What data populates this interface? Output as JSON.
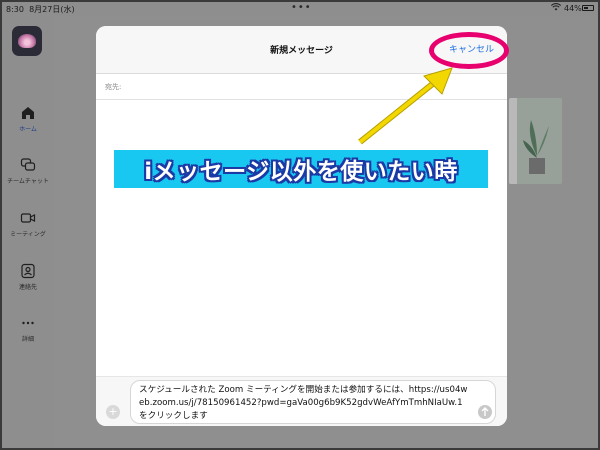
{
  "status_bar": {
    "time": "8:30",
    "date": "8月27日(水)",
    "battery": "44%"
  },
  "sidebar": {
    "items": [
      {
        "label": "ホーム",
        "icon": "home-icon",
        "active": true
      },
      {
        "label": "チームチャット",
        "icon": "chat-icon",
        "active": false
      },
      {
        "label": "ミーティング",
        "icon": "video-icon",
        "active": false
      },
      {
        "label": "連絡先",
        "icon": "contacts-icon",
        "active": false
      },
      {
        "label": "詳細",
        "icon": "more-icon",
        "active": false
      }
    ]
  },
  "modal": {
    "title": "新規メッセージ",
    "cancel_label": "キャンセル",
    "to_label": "宛先:",
    "message_text": "スケジュールされた Zoom ミーティングを開始または参加するには、https://us04web.zoom.us/j/78150961452?pwd=gaVa00g6b9K52gdvWeAfYmTmhNIaUw.1 をクリックします"
  },
  "annotation": {
    "banner_text": "iメッセージ以外を使いたい時",
    "highlight_color": "#e8006f",
    "arrow_color": "#f2d800",
    "banner_color": "#19c8f0"
  }
}
